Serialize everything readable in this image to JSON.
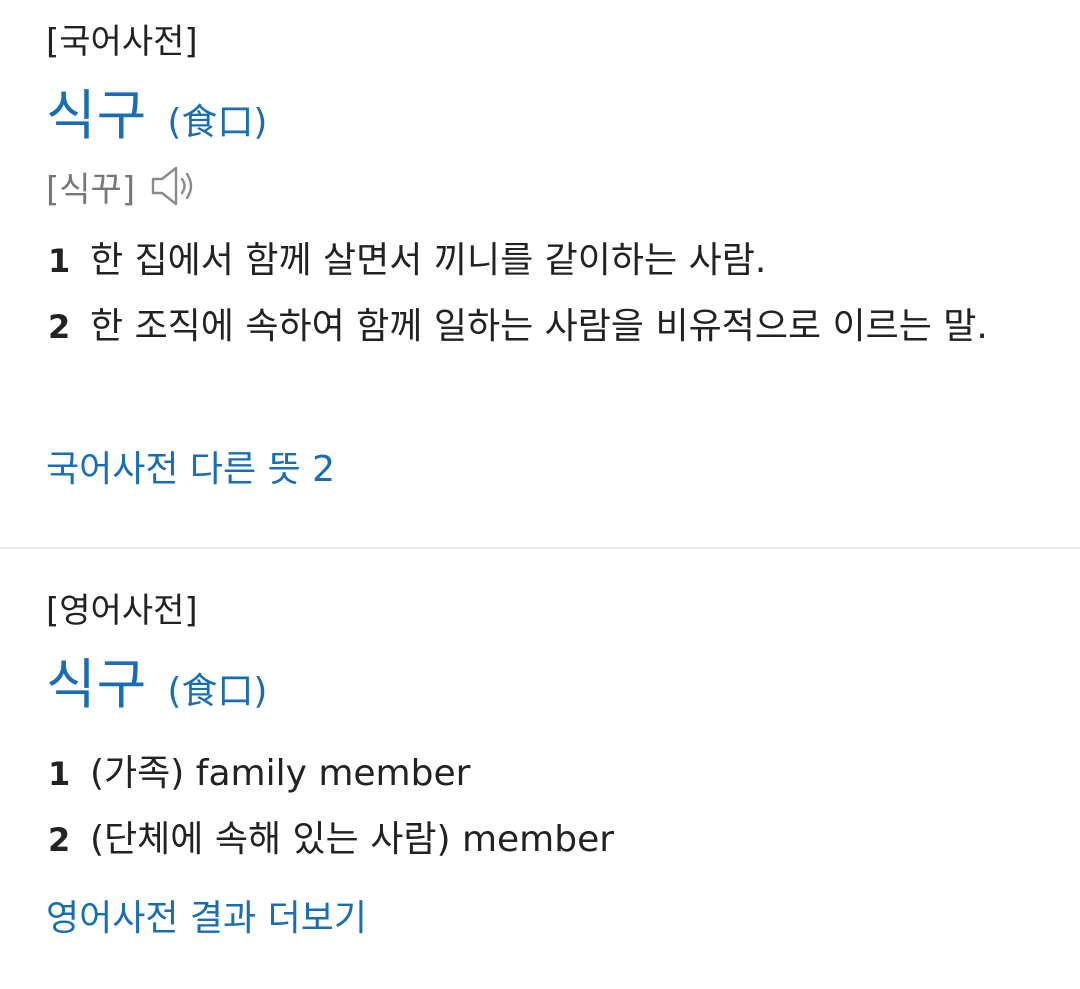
{
  "korean_dict": {
    "label": "[국어사전]",
    "headword": "식구",
    "hanja": "(食口)",
    "pronunciation": "[식꾸]",
    "speaker_icon": "speaker-icon",
    "definitions": [
      {
        "num": "1",
        "text": "한 집에서 함께 살면서 끼니를 같이하는 사람."
      },
      {
        "num": "2",
        "text": "한 조직에 속하여 함께 일하는 사람을 비유적으로 이르는 말."
      }
    ],
    "more_link": "국어사전 다른 뜻 2"
  },
  "english_dict": {
    "label": "[영어사전]",
    "headword": "식구",
    "hanja": "(食口)",
    "definitions": [
      {
        "num": "1",
        "text": "(가족) family member"
      },
      {
        "num": "2",
        "text": "(단체에 속해 있는 사람) member"
      }
    ],
    "more_link": "영어사전 결과 더보기"
  },
  "colors": {
    "accent": "#1a6db5",
    "text": "#222222",
    "muted": "#777777",
    "divider": "#ebebeb"
  }
}
